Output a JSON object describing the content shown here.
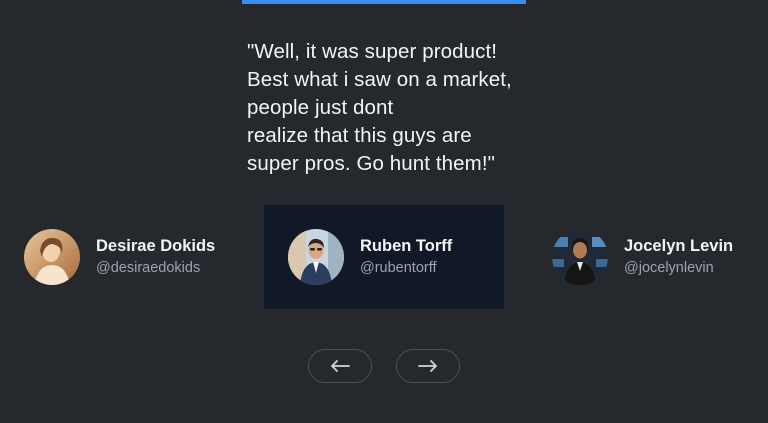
{
  "quote": {
    "lines": [
      "\"Well, it was super product!",
      "Best what i saw on a market,",
      "people just dont",
      "realize that this guys are",
      "super pros. Go hunt them!\""
    ]
  },
  "testimonials": [
    {
      "name": "Desirae Dokids",
      "handle": "@desiraedokids",
      "active": false
    },
    {
      "name": "Ruben Torff",
      "handle": "@rubentorff",
      "active": true
    },
    {
      "name": "Jocelyn Levin",
      "handle": "@jocelynlevin",
      "active": false
    }
  ],
  "nav": {
    "prev_icon": "arrow-left-icon",
    "next_icon": "arrow-right-icon"
  },
  "colors": {
    "background": "#25292e",
    "active_card": "#111827",
    "accent": "#3b8ef0"
  }
}
